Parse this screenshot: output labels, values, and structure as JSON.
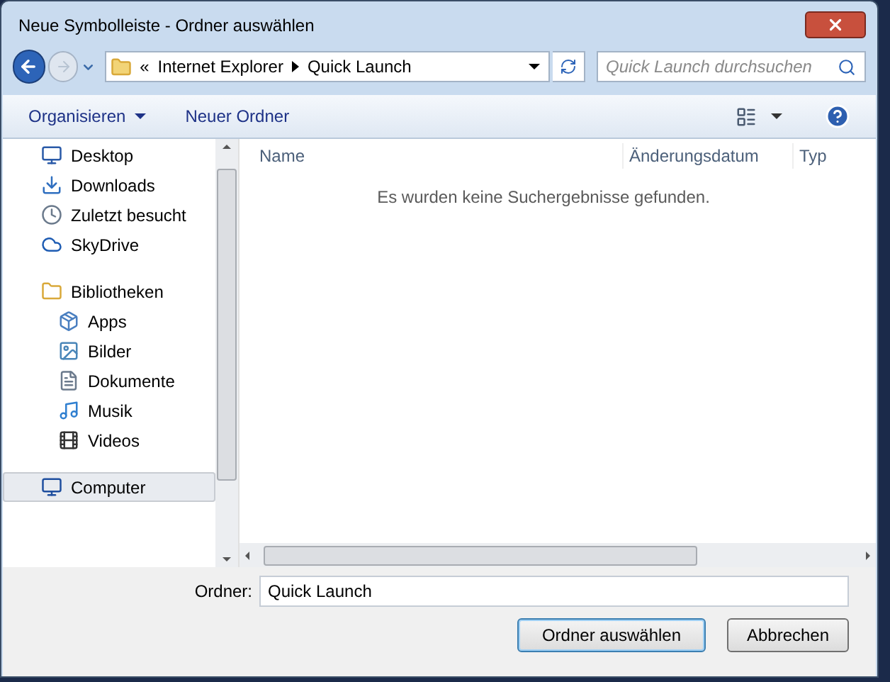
{
  "window": {
    "title": "Neue Symbolleiste - Ordner auswählen"
  },
  "address": {
    "overflow": "«",
    "crumbs": [
      "Internet Explorer",
      "Quick Launch"
    ]
  },
  "search": {
    "placeholder": "Quick Launch durchsuchen"
  },
  "toolbar": {
    "organize": "Organisieren",
    "new_folder": "Neuer Ordner"
  },
  "sidebar": {
    "items": [
      {
        "label": "Desktop",
        "kind": "desktop",
        "selected": false
      },
      {
        "label": "Downloads",
        "kind": "downloads",
        "selected": false
      },
      {
        "label": "Zuletzt besucht",
        "kind": "recent",
        "selected": false
      },
      {
        "label": "SkyDrive",
        "kind": "cloud",
        "selected": false
      },
      {
        "label": "Bibliotheken",
        "kind": "libraries",
        "selected": false,
        "children": [
          {
            "label": "Apps",
            "kind": "apps",
            "selected": false
          },
          {
            "label": "Bilder",
            "kind": "pictures",
            "selected": false
          },
          {
            "label": "Dokumente",
            "kind": "documents",
            "selected": false
          },
          {
            "label": "Musik",
            "kind": "music",
            "selected": false
          },
          {
            "label": "Videos",
            "kind": "videos",
            "selected": false
          }
        ]
      },
      {
        "label": "Computer",
        "kind": "computer",
        "selected": true
      }
    ]
  },
  "table": {
    "columns": [
      "Name",
      "Änderungsdatum",
      "Typ"
    ],
    "empty_message": "Es wurden keine Suchergebnisse gefunden."
  },
  "folder_field": {
    "label": "Ordner:",
    "value": "Quick Launch"
  },
  "buttons": [
    {
      "label": "Ordner auswählen",
      "default": true
    },
    {
      "label": "Abbrechen",
      "default": false
    }
  ]
}
